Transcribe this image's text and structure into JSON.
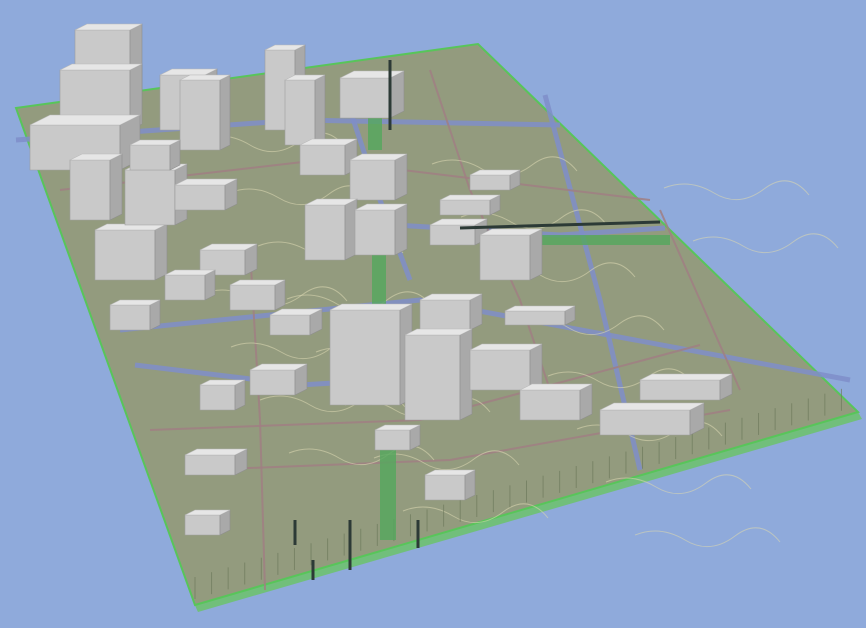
{
  "scene": {
    "background_color": "#8faadb",
    "terrain_color": "#939b7e",
    "terrain_edge_color": "#58c55a",
    "building_top_color": "#e6e6e6",
    "building_left_color": "#c9c9c9",
    "building_right_color": "#a9a9a9",
    "major_road_color": "#7f8ec9",
    "minor_road_color": "#a07f82",
    "park_strip_color": "#54a85c",
    "contour_color": "#d9d6b0",
    "dark_line_color": "#2c3a36"
  }
}
